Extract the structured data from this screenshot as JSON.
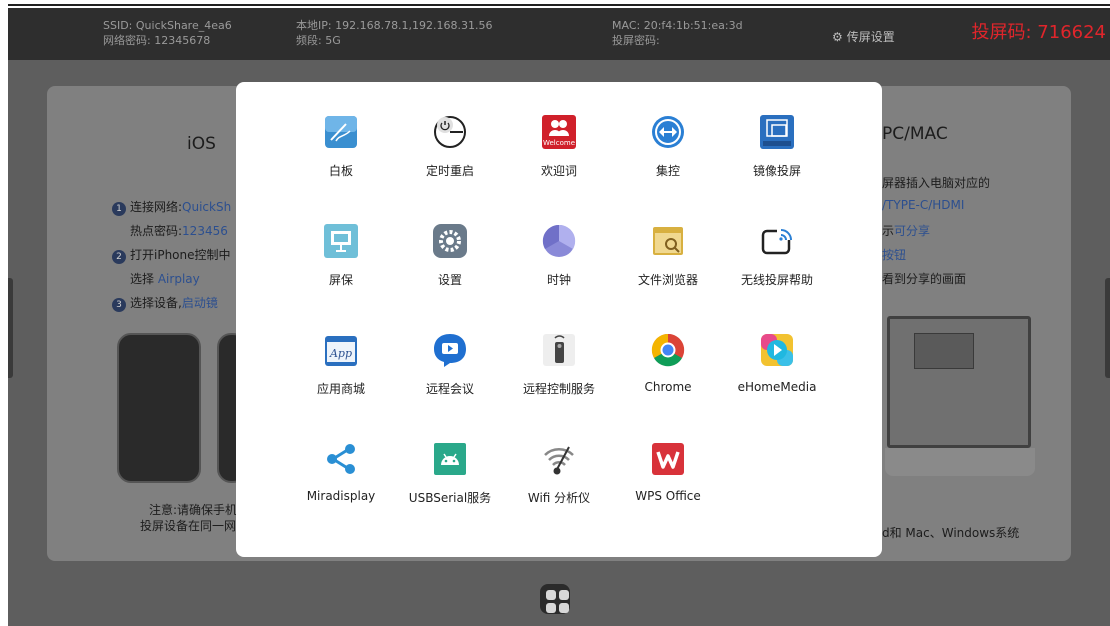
{
  "topbar": {
    "ssid": "SSID: QuickShare_4ea6",
    "wifi_password": "网络密码: 12345678",
    "local_ip": "本地IP: 192.168.78.1,192.168.31.56",
    "band": "频段: 5G",
    "mac": "MAC: 20:f4:1b:51:ea:3d",
    "cast_password": "投屏密码:",
    "settings_label": "传屏设置",
    "cast_code": "投屏码: 716624",
    "cast_code_color": "#e0252b"
  },
  "background": {
    "ios_title": "iOS",
    "ios_step1": "连接网络:",
    "ios_step1_value": "QuickSh",
    "ios_hotspot": "热点密码:",
    "ios_hotspot_value": "123456",
    "ios_step2": "打开iPhone控制中",
    "ios_airplay_prefix": "选择",
    "ios_airplay": "Airplay",
    "ios_step3": "选择设备,",
    "ios_step3_value": "启动镜",
    "ios_note1": "注意:请确保手机",
    "ios_note2": "投屏设备在同一网",
    "pc_title": "PC/MAC",
    "pc_line1": "屏器插入电脑对应的",
    "pc_line2": "/TYPE-C/HDMI",
    "pc_line3_prefix": "示",
    "pc_line3": "可分享",
    "pc_line4": "按钮",
    "pc_line5": "看到分享的画面",
    "pc_footer": "d和 Mac、Windows系统"
  },
  "apps": [
    {
      "label": "白板",
      "icon": "whiteboard-icon",
      "color": "#3a8fd0"
    },
    {
      "label": "定时重启",
      "icon": "power-timer-icon",
      "color": "#333333"
    },
    {
      "label": "欢迎词",
      "icon": "welcome-icon",
      "color": "#d0202a"
    },
    {
      "label": "集控",
      "icon": "central-control-icon",
      "color": "#2a7fd4"
    },
    {
      "label": "镜像投屏",
      "icon": "mirror-cast-icon",
      "color": "#2a6fbf"
    },
    {
      "label": "屏保",
      "icon": "screensaver-icon",
      "color": "#6fbfd8"
    },
    {
      "label": "设置",
      "icon": "settings-icon",
      "color": "#6a7a8a"
    },
    {
      "label": "时钟",
      "icon": "clock-icon",
      "color": "#8a8ad8"
    },
    {
      "label": "文件浏览器",
      "icon": "file-browser-icon",
      "color": "#d8b040"
    },
    {
      "label": "无线投屏帮助",
      "icon": "wireless-cast-help-icon",
      "color": "#222222"
    },
    {
      "label": "应用商城",
      "icon": "app-store-icon",
      "color": "#2a6fbf"
    },
    {
      "label": "远程会议",
      "icon": "remote-meeting-icon",
      "color": "#1f6fd0"
    },
    {
      "label": "远程控制服务",
      "icon": "remote-control-icon",
      "color": "#555555"
    },
    {
      "label": "Chrome",
      "icon": "chrome-icon",
      "color": "#4285f4"
    },
    {
      "label": "eHomeMedia",
      "icon": "ehome-media-icon",
      "color": "#20b8e0"
    },
    {
      "label": "Miradisplay",
      "icon": "share-icon",
      "color": "#2a8fd4"
    },
    {
      "label": "USBSerial服务",
      "icon": "android-icon",
      "color": "#2aa88a"
    },
    {
      "label": "Wifi 分析仪",
      "icon": "wifi-analyzer-icon",
      "color": "#888888"
    },
    {
      "label": "WPS Office",
      "icon": "wps-office-icon",
      "color": "#d8323a"
    }
  ]
}
